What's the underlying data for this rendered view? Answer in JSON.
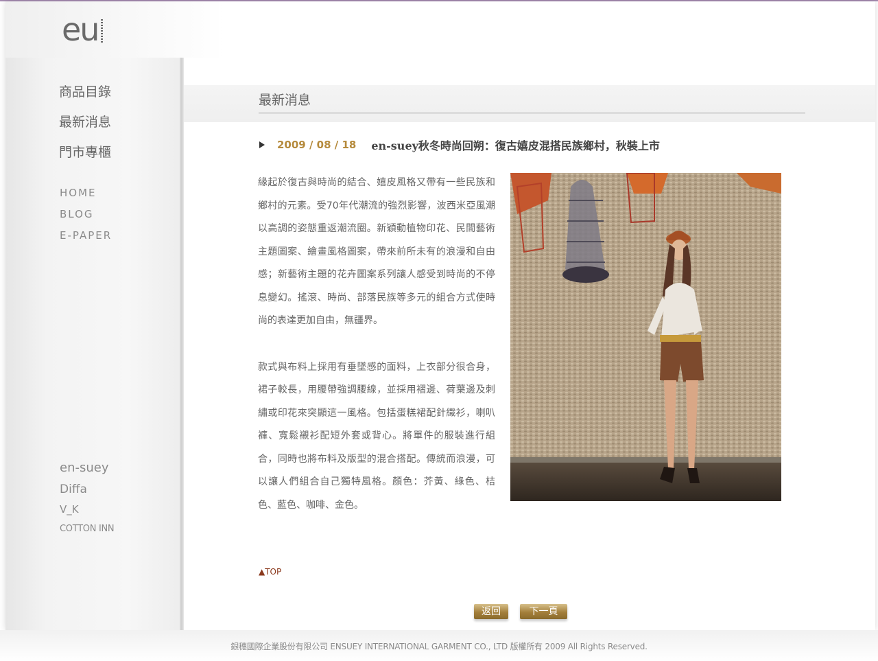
{
  "logo": {
    "text": "eu"
  },
  "nav": {
    "main": [
      "商品目錄",
      "最新消息",
      "門市專櫃"
    ],
    "sub": [
      "HOME",
      "BLOG",
      "E-PAPER"
    ],
    "brands": [
      "en-suey",
      "Diffa",
      "V_K",
      "COTTON INN"
    ]
  },
  "section": {
    "title": "最新消息"
  },
  "post": {
    "date": "2009 / 08 / 18",
    "title": "en-suey秋冬時尚回朔：復古嬉皮混搭民族鄉村，秋裝上市",
    "paragraphs": [
      "緣起於復古與時尚的結合、嬉皮風格又帶有一些民族和鄉村的元素。受70年代潮流的強烈影響，波西米亞風潮以高調的姿態重返潮流圈。新穎動植物印花、民間藝術主題圖案、繪畫風格圖案，帶來前所未有的浪漫和自由感；新藝術主題的花卉圖案系列讓人感受到時尚的不停息變幻。搖滾、時尚、部落民族等多元的組合方式使時尚的表達更加自由，無疆界。",
      "款式與布料上採用有垂墜感的面料，上衣部分很合身，裙子較長，用腰帶強調腰線，並採用褶邊、荷葉邊及刺繡或印花來突顯這一風格。包括蛋糕裙配針織衫，喇叭褲、寬鬆襯衫配短外套或背心。將單件的服裝進行組合，同時也將布料及版型的混合搭配。傳統而浪漫，可以讓人們組合自己獨特風格。顏色：芥黃、綠色、桔色、藍色、咖啡、金色。"
    ]
  },
  "links": {
    "top": "▲TOP"
  },
  "buttons": {
    "back": "返回",
    "next": "下一頁"
  },
  "footer": {
    "text": "銀穗國際企業股份有限公司   ENSUEY INTERNATIONAL GARMENT CO., LTD   版權所有   2009 All Rights Reserved."
  },
  "colors": {
    "accent": "#b58a3c",
    "button": "#a47f3b",
    "top_link": "#8b3a1e"
  }
}
